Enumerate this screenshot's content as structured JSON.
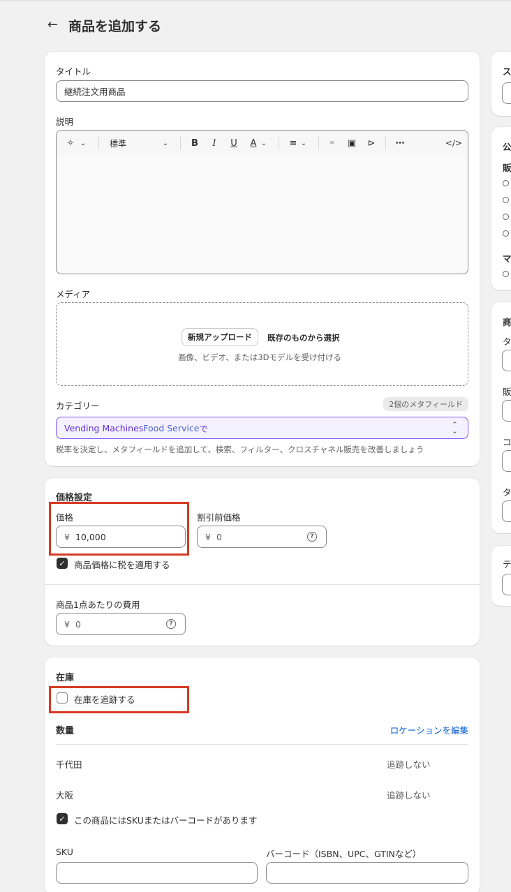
{
  "page": {
    "title": "商品を追加する",
    "back_icon": "←"
  },
  "product": {
    "title_label": "タイトル",
    "title_value": "継続注文用商品",
    "description_label": "説明",
    "toolbar": {
      "style_label": "標準"
    },
    "media_label": "メディア",
    "upload_button": "新規アップロード",
    "select_existing": "既存のものから選択",
    "media_hint": "画像、ビデオ、または3Dモデルを受け付ける",
    "category_label": "カテゴリー",
    "metafield_badge": "2個のメタフィールド",
    "category_value_1": "Vending Machines ",
    "category_value_2": "Food Service",
    "category_value_3": "で",
    "category_help": "税率を決定し、メタフィールドを追加して、検索、フィルター、クロスチャネル販売を改善しましょう"
  },
  "pricing": {
    "title": "価格設定",
    "price_label": "価格",
    "price_currency": "¥",
    "price_value": "10,000",
    "compare_label": "割引前価格",
    "compare_currency": "¥",
    "compare_value": "0",
    "tax_label": "商品価格に税を適用する",
    "cost_label": "商品1点あたりの費用",
    "cost_currency": "¥",
    "cost_value": "0"
  },
  "inventory": {
    "title": "在庫",
    "track_label": "在庫を追跡する",
    "quantity_label": "数量",
    "edit_locations": "ロケーションを編集",
    "locations": [
      {
        "name": "千代田",
        "status": "追跡しない"
      },
      {
        "name": "大阪",
        "status": "追跡しない"
      }
    ],
    "sku_checkbox_label": "この商品にはSKUまたはバーコードがあります",
    "sku_label": "SKU",
    "barcode_label": "バーコード（ISBN、UPC、GTINなど）"
  },
  "sidebar": {
    "status_heading": "ス",
    "publishing_heading": "公",
    "sales_heading": "販",
    "markets_heading": "マ",
    "org_heading": "商",
    "org_field_1": "タ",
    "org_field_2": "販",
    "org_field_3": "コ",
    "org_field_4": "タ",
    "theme_heading": "テ"
  },
  "colors": {
    "highlight": "#d73a25",
    "link": "#005bd3",
    "category_text": "#5e2fdc"
  }
}
